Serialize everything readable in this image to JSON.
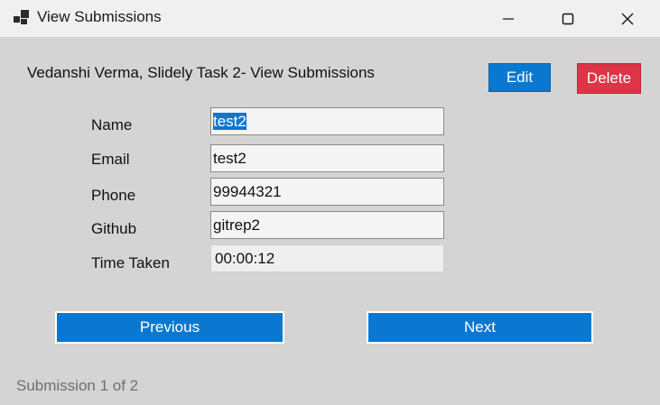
{
  "window": {
    "title": "View Submissions"
  },
  "header": {
    "text": "Vedanshi Verma, Slidely Task 2- View Submissions"
  },
  "buttons": {
    "edit": "Edit",
    "delete": "Delete",
    "previous": "Previous",
    "next": "Next"
  },
  "fields": {
    "name": {
      "label": "Name",
      "value": "test2"
    },
    "email": {
      "label": "Email",
      "value": "test2"
    },
    "phone": {
      "label": "Phone",
      "value": "99944321"
    },
    "github": {
      "label": "Github",
      "value": "gitrep2"
    },
    "time_taken": {
      "label": "Time Taken",
      "value": "00:00:12"
    }
  },
  "status": {
    "text": "Submission 1 of 2"
  },
  "colors": {
    "primary": "#0a78d1",
    "danger": "#dc3545",
    "background": "#d4d4d4"
  },
  "icons": [
    "app-icon",
    "minimize-icon",
    "maximize-icon",
    "close-icon"
  ]
}
